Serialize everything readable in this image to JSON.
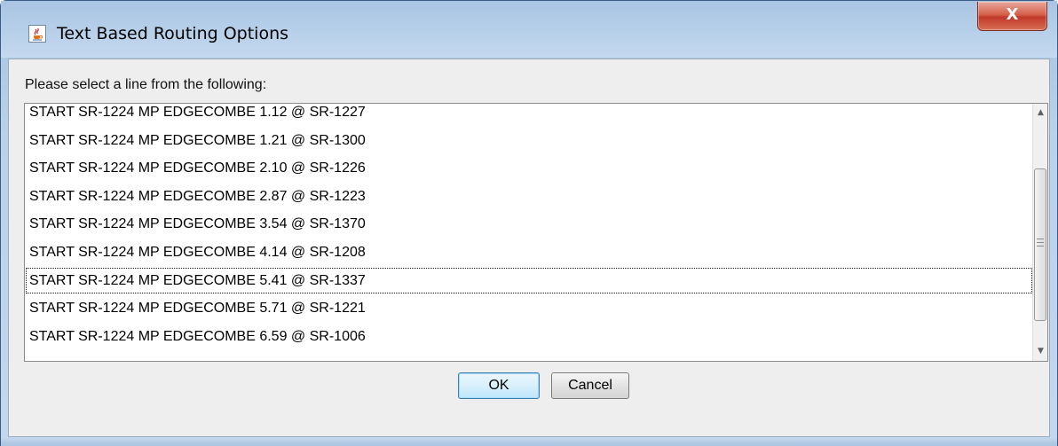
{
  "window": {
    "title": "Text Based Routing Options",
    "close_label": "X"
  },
  "dialog": {
    "prompt": "Please select a line from the following:",
    "items": [
      "START SR-1224 MP EDGECOMBE 1.12 @ SR-1227",
      "START SR-1224 MP EDGECOMBE 1.21 @ SR-1300",
      "START SR-1224 MP EDGECOMBE 2.10 @ SR-1226",
      "START SR-1224 MP EDGECOMBE 2.87 @ SR-1223",
      "START SR-1224 MP EDGECOMBE 3.54 @ SR-1370",
      "START SR-1224 MP EDGECOMBE 4.14 @ SR-1208",
      "START SR-1224 MP EDGECOMBE 5.41 @ SR-1337",
      "START SR-1224 MP EDGECOMBE 5.71 @ SR-1221",
      "START SR-1224 MP EDGECOMBE 6.59 @ SR-1006"
    ],
    "focused_item": "START SR-1224 MP EDGECOMBE 5.41 @ SR-1337",
    "ok_label": "OK",
    "cancel_label": "Cancel"
  },
  "icons": {
    "app": "java-coffee-cup-icon",
    "close": "close-icon",
    "scroll_up": "scroll-up-arrow-icon",
    "scroll_down": "scroll-down-arrow-icon"
  },
  "colors": {
    "titlebar": "#b6cfe9",
    "close_button": "#c0392b",
    "dialog_background": "#eeeeee",
    "default_button_border": "#3c7fb1"
  }
}
